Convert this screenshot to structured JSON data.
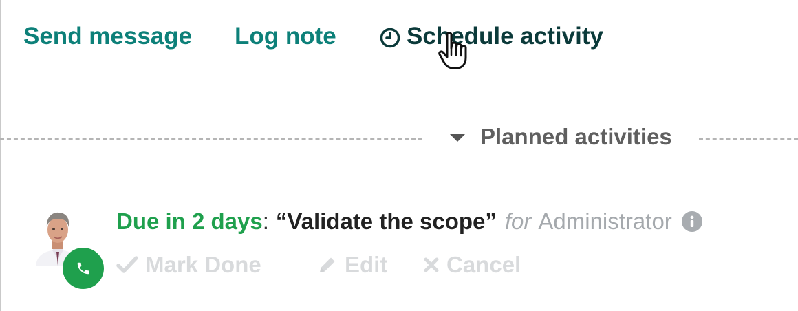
{
  "composer": {
    "send_message": "Send message",
    "log_note": "Log note",
    "schedule_activity": "Schedule activity",
    "schedule_icon": "clock-icon"
  },
  "planned": {
    "title": "Planned activities",
    "toggle_icon": "caret-down-icon"
  },
  "activity": {
    "due": "Due in 2 days",
    "separator": ":",
    "summary": "“Validate the scope”",
    "for_word": "for",
    "assignee": "Administrator",
    "type_icon": "phone-icon",
    "type_color": "#1fa04d",
    "actions": {
      "mark_done": "Mark Done",
      "edit": "Edit",
      "cancel": "Cancel"
    }
  },
  "colors": {
    "link": "#0d8079",
    "link_hover": "#0b3a3a",
    "due": "#1fa04d",
    "muted": "#a5a9ad",
    "action_disabled": "#d8dadc"
  }
}
